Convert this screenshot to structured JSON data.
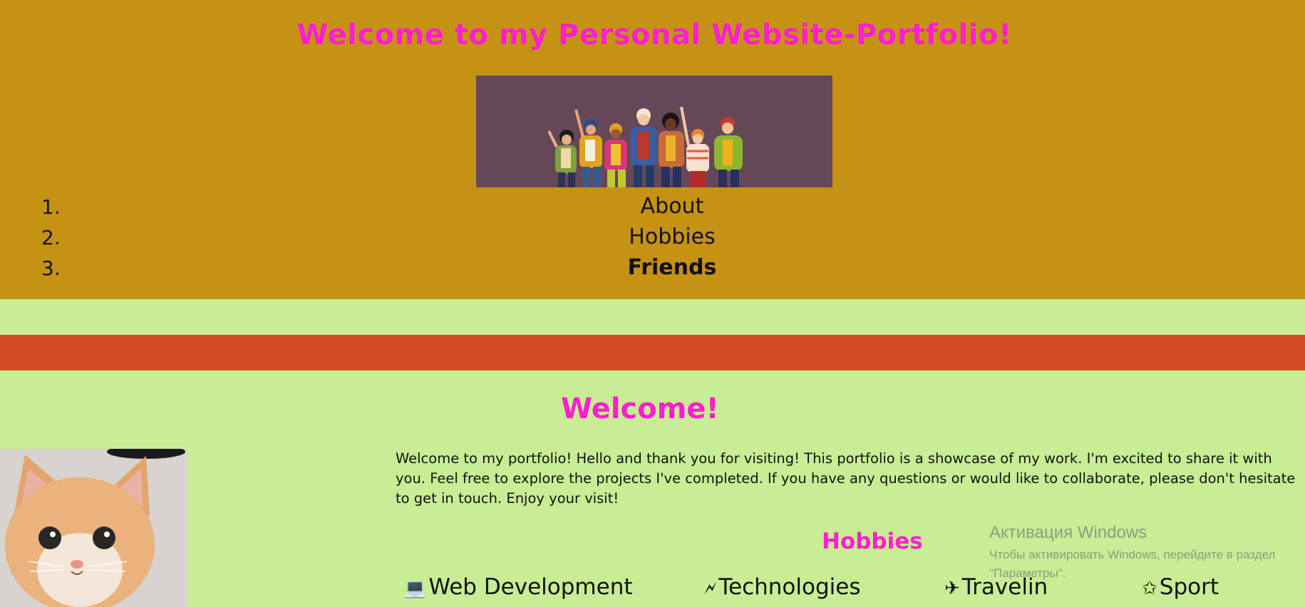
{
  "header": {
    "title": "Welcome to my Personal Website-Portfolio!",
    "banner_alt": "group-of-people-illustration"
  },
  "nav": {
    "items": [
      {
        "number": "1.",
        "label": "About"
      },
      {
        "number": "2.",
        "label": "Hobbies"
      },
      {
        "number": "3.",
        "label": "Friends"
      }
    ]
  },
  "main": {
    "welcome_title": "Welcome!",
    "intro_text": "Welcome to my portfolio! Hello and thank you for visiting! This portfolio is a showcase of my work. I'm excited to share it with you. Feel free to explore the projects I've completed. If you have any questions or would like to collaborate, please don't hesitate to get in touch. Enjoy your visit!",
    "hobbies_title": "Hobbies",
    "hobbies": [
      {
        "icon": "💻",
        "label": "Web Development"
      },
      {
        "icon": "🗲",
        "label": "Technologies"
      },
      {
        "icon": "✈",
        "label": "Travelin"
      },
      {
        "icon": "✩",
        "label": "Sport"
      }
    ]
  },
  "watermark": {
    "title": "Активация Windows",
    "text": "Чтобы активировать Windows, перейдите в раздел \"Параметры\"."
  },
  "colors": {
    "header_bg": "#c69214",
    "page_bg": "#c8ed94",
    "band_red": "#d24d24",
    "accent_pink": "#ff1fd0"
  }
}
